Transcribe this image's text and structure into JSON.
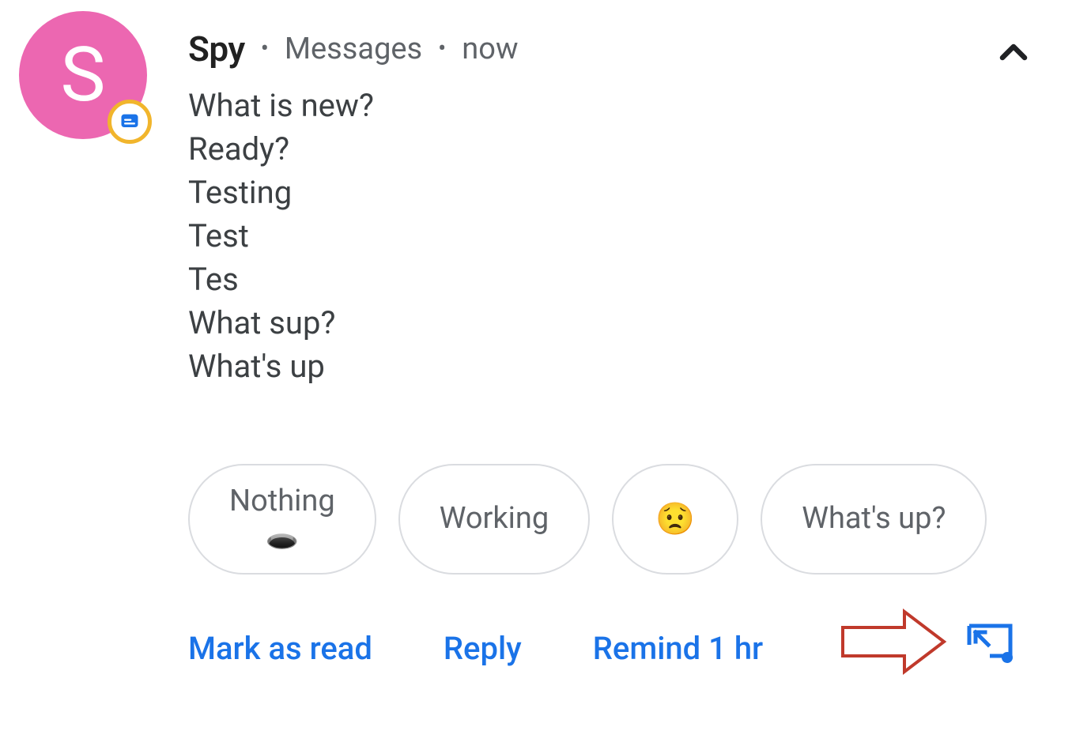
{
  "avatar": {
    "initial": "S",
    "bg_color": "#ec67b1",
    "badge_icon": "messages-icon"
  },
  "header": {
    "sender": "Spy",
    "app": "Messages",
    "time": "now"
  },
  "messages": [
    "What is new?",
    "Ready?",
    "Testing",
    "Test",
    "Tes",
    "What sup?",
    "What's up"
  ],
  "suggestions": [
    {
      "label": "Nothing",
      "emoji": "🕳️"
    },
    {
      "label": "Working"
    },
    {
      "emoji": "😟"
    },
    {
      "label": "What's up?"
    }
  ],
  "actions": {
    "mark_as_read": "Mark as read",
    "reply": "Reply",
    "remind": "Remind 1 hr"
  },
  "colors": {
    "link": "#1a73e8",
    "text_secondary": "#5f6368",
    "annotation": "#c0392b"
  }
}
